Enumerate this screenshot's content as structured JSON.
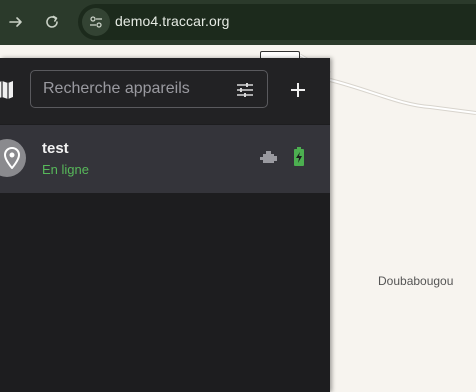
{
  "browser": {
    "url": "demo4.traccar.org",
    "icons": [
      "forward-arrow-icon",
      "reload-icon",
      "site-info-icon"
    ]
  },
  "map": {
    "place_label": "Doubabougou"
  },
  "sidebar": {
    "search": {
      "placeholder": "Recherche appareils",
      "value": ""
    },
    "icons": [
      "map-icon",
      "filter-sliders-icon",
      "add-icon"
    ]
  },
  "devices": [
    {
      "name": "test",
      "status": "En ligne",
      "status_color": "#57b85a",
      "icons": [
        "location-pin-icon",
        "engine-icon",
        "battery-charging-icon"
      ],
      "battery_color": "#4caf50"
    }
  ],
  "colors": {
    "browser_bar": "#2b3a2b",
    "panel": "#1d1d1f",
    "selected_row": "#34343a",
    "map_background": "#f7f4ef"
  }
}
